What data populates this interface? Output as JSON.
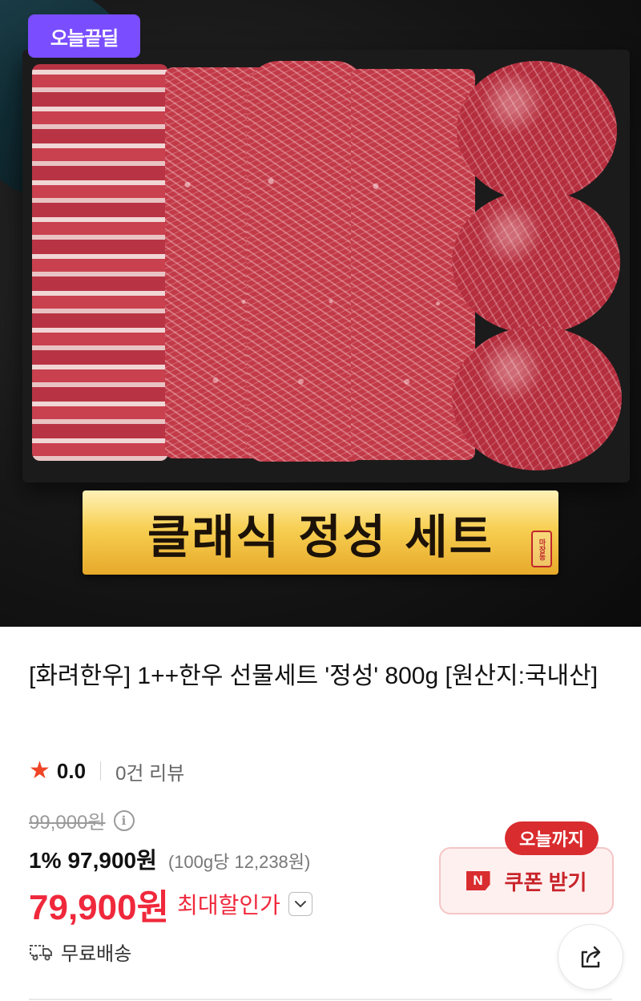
{
  "hero": {
    "badge_label": "오늘끝딜",
    "banner_text": "클래식 정성 세트",
    "stamp_text": "마장동"
  },
  "product": {
    "title": "[화려한우] 1++한우 선물세트 '정성' 800g [원산지:국내산]",
    "rating_score": "0.0",
    "review_count": "0건 리뷰",
    "original_price": "99,000원",
    "discount_rate": "1%",
    "discount_price": "97,900원",
    "unit_price": "(100g당 12,238원)",
    "final_price": "79,900원",
    "final_label": "최대할인가",
    "shipping_label": "무료배송"
  },
  "coupon": {
    "tag": "오늘까지",
    "icon_letter": "N",
    "label": "쿠폰 받기"
  },
  "colors": {
    "accent_red": "#f0283c",
    "badge_purple": "#7a4dff",
    "coupon_red": "#d92c2f",
    "star_orange": "#f04426"
  },
  "icons": {
    "star": "star-icon",
    "info": "info-icon",
    "chevron": "chevron-down-icon",
    "truck": "truck-icon",
    "share": "share-icon"
  }
}
